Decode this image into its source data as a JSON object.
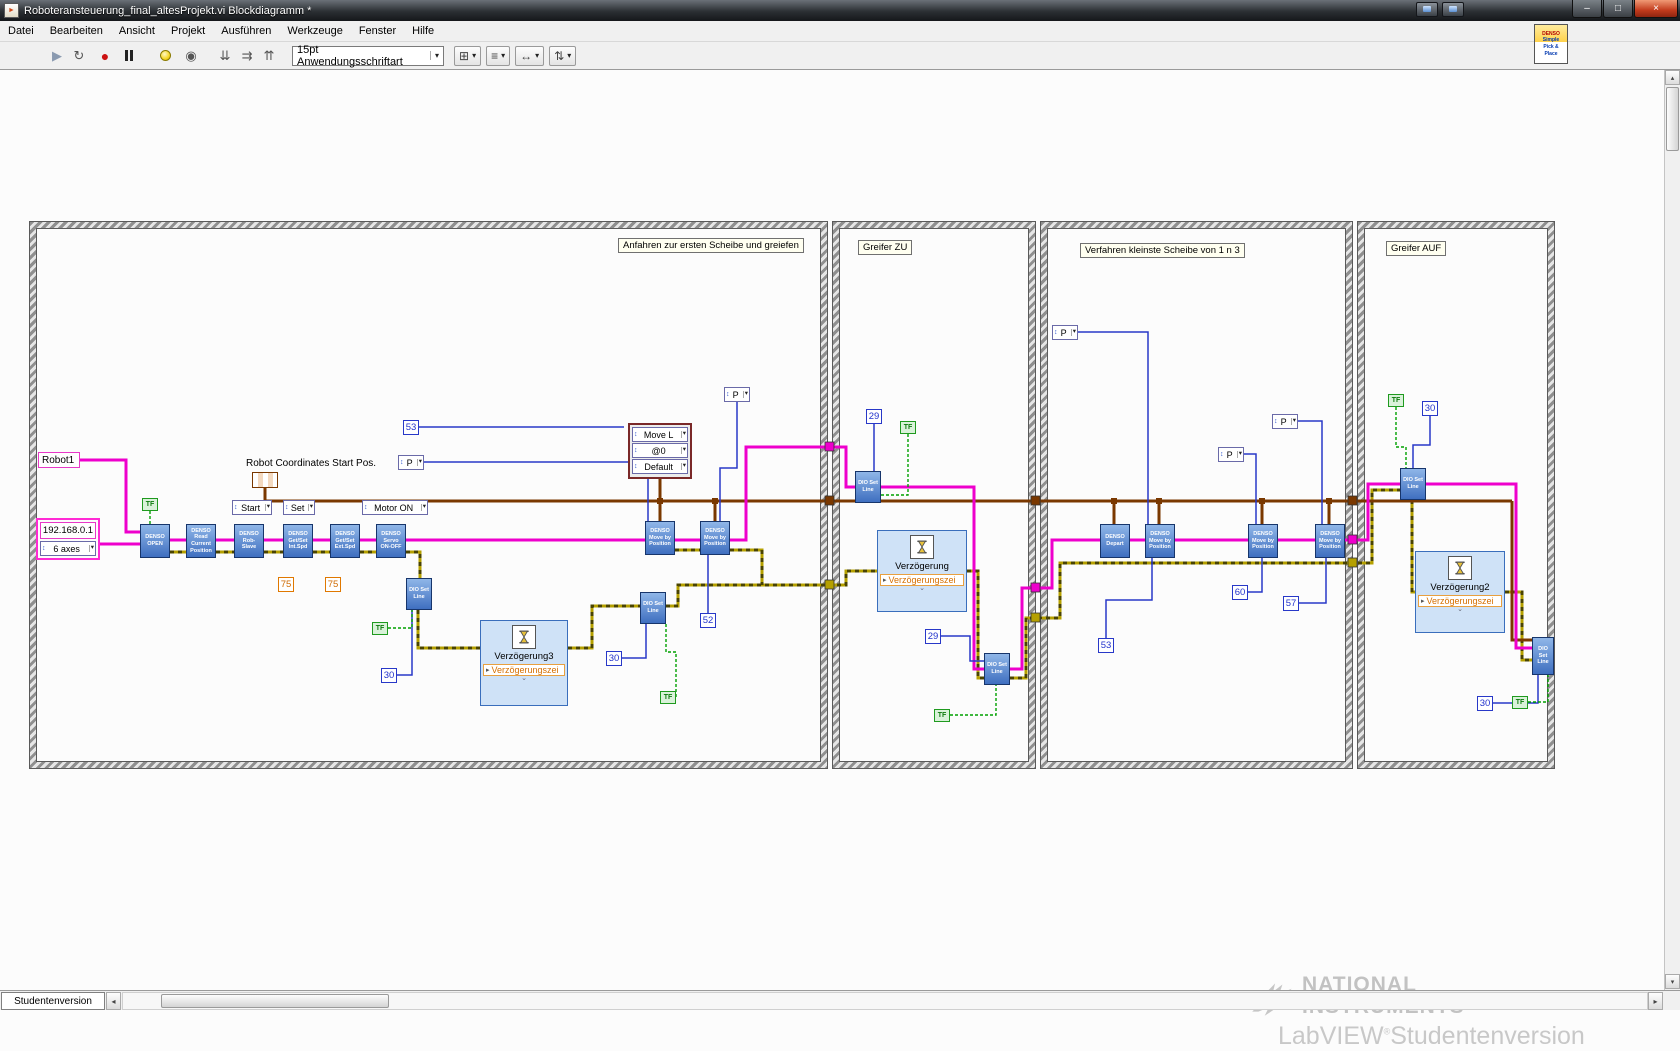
{
  "window": {
    "title": "Roboteransteuerung_final_altesProjekt.vi Blockdiagramm *",
    "badge": [
      "DENSO",
      "Simple",
      "Pick &",
      "Place"
    ],
    "buttons": {
      "minimize": "–",
      "maximize": "□",
      "close": "×"
    }
  },
  "menu": {
    "items": [
      "Datei",
      "Bearbeiten",
      "Ansicht",
      "Projekt",
      "Ausführen",
      "Werkzeuge",
      "Fenster",
      "Hilfe"
    ]
  },
  "toolbar": {
    "font": "15pt Anwendungsschriftart",
    "icons": {
      "run": "▶",
      "run_continuous": "↻",
      "abort": "●",
      "step_into": "⇊",
      "step_over": "⇉",
      "step_out": "⇈",
      "retain_values": "◉",
      "align": "⊞",
      "distribute": "≡",
      "resize": "↔",
      "reorder": "⇅",
      "help": "?"
    }
  },
  "ui": {
    "ring_glyph": "↕",
    "dropdown": "▾",
    "param_arrow": "▸",
    "chevron": "⌄",
    "scroll_left": "◂",
    "scroll_right": "▸",
    "scroll_up": "▴",
    "scroll_down": "▾"
  },
  "frames": {
    "f1_label": "Anfahren zur ersten Scheibe und greiefen",
    "f2_label": "Greifer ZU",
    "f3_label": "Verfahren kleinste Scheibe von 1 n 3",
    "f4_label": "Greifer AUF"
  },
  "diagram": {
    "free_label": "Robot Coordinates Start Pos.",
    "robot_name": "Robot1",
    "ip": "192.168.0.1",
    "axes": "6 axes",
    "blocks": {
      "open": "DENSO OPEN",
      "read_pos": "DENSO Read Current Position",
      "rob_slave": "DENSO Rob-Slave",
      "int_spd": "DENSO Get/Set Int.Spd",
      "ext_spd": "DENSO Get/Set Ext.Spd",
      "servo": "DENSO Servo ON-OFF",
      "depart": "DENSO Depart",
      "move": "DENSO Move by Position",
      "dio": "DIO Set Line",
      "delay1": "Verzögerung",
      "delay2": "Verzögerung2",
      "delay3": "Verzögerung3",
      "delay_param": "Verzögerungszei"
    },
    "rings": {
      "start": "Start",
      "set": "Set",
      "motor_on": "Motor ON",
      "p": "P",
      "move_l": "Move L",
      "at0": "@0",
      "default": "Default"
    },
    "constants": {
      "c29": "29",
      "c30": "30",
      "c52": "52",
      "c53": "53",
      "c57": "57",
      "c60": "60",
      "c75": "75",
      "tf": "TF"
    }
  },
  "statusbar": {
    "tab": "Studentenversion"
  },
  "watermark": {
    "brand_top": "NATIONAL",
    "brand_bottom": "INSTRUMENTS",
    "tm": "™",
    "product": "LabVIEW",
    "reg": "®",
    "edition": "Studentenversion"
  },
  "colors": {
    "wire_ref": "#ee00cc",
    "wire_cluster": "#7a3800",
    "wire_int": "#2838c8",
    "wire_bool": "#00a000",
    "wire_error": "#b5a000"
  }
}
